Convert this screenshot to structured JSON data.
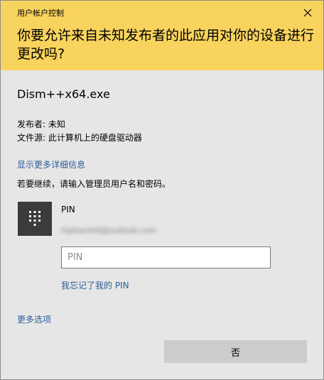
{
  "window": {
    "title": "用户帐户控制",
    "close_icon": "close-icon"
  },
  "header": {
    "question": "你要允许来自未知发布者的此应用对你的设备进行更改吗?",
    "background_color": "#f8d35d"
  },
  "app": {
    "name": "Dism++x64.exe",
    "publisher": "发布者: 未知",
    "file_origin": "文件源: 此计算机上的硬盘驱动器"
  },
  "links": {
    "show_details": "显示更多详细信息",
    "more_options": "更多选项",
    "forgot_pin": "我忘记了我的 PIN",
    "link_color": "#2f5f9b"
  },
  "auth": {
    "prompt": "若要继续，请输入管理员用户名和密码。",
    "avatar_icon": "pin-keypad-icon",
    "method_label": "PIN",
    "account_email": "hipharoh0@outlook.com",
    "pin_input": {
      "placeholder": "PIN",
      "value": ""
    }
  },
  "buttons": {
    "no_label": "否"
  }
}
